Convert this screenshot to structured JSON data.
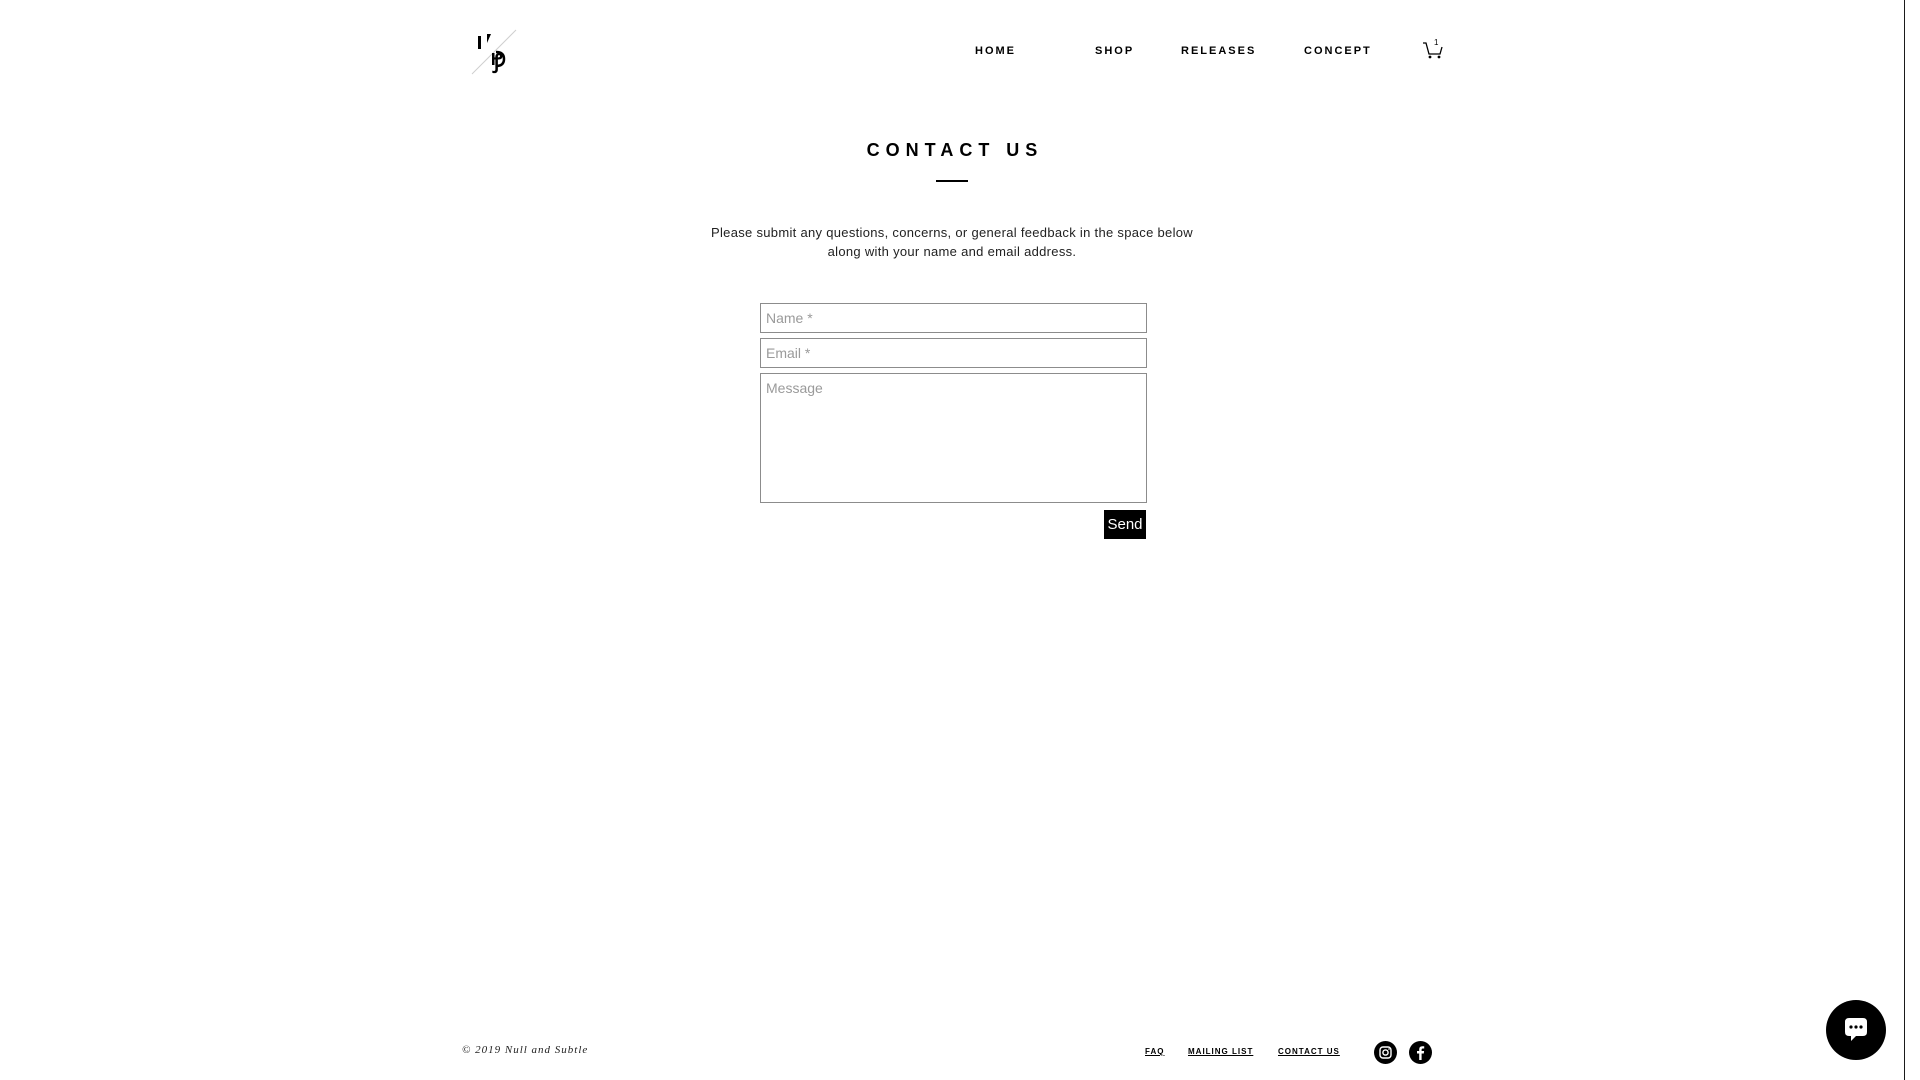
{
  "header": {
    "nav": [
      {
        "label": "HOME"
      },
      {
        "label": "SHOP"
      },
      {
        "label": "RELEASES"
      },
      {
        "label": "CONCEPT"
      }
    ],
    "cart_count": "1"
  },
  "main": {
    "title": "CONTACT US",
    "intro_line1": "Please submit any questions, concerns, or general feedback in the space below",
    "intro_line2": "along with your name and email address.",
    "form": {
      "name_placeholder": "Name *",
      "email_placeholder": "Email *",
      "message_placeholder": "Message",
      "send_label": "Send"
    }
  },
  "footer": {
    "copyright": "© 2019 Null and Subtle",
    "links": [
      {
        "label": "FAQ"
      },
      {
        "label": "MAILING LIST"
      },
      {
        "label": "CONTACT US"
      }
    ]
  },
  "icons": {
    "logo": "logo-icon",
    "cart": "cart-icon",
    "instagram": "instagram-icon",
    "facebook": "facebook-icon",
    "chat": "chat-icon"
  },
  "colors": {
    "text": "#000000",
    "background": "#ffffff",
    "button": "#000000"
  }
}
